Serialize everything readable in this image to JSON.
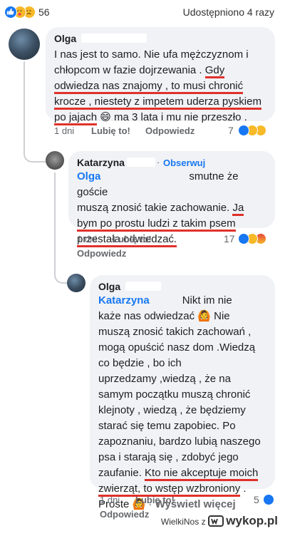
{
  "post": {
    "reaction_count": "56",
    "shares": "Udostępniono 4 razy"
  },
  "comment1": {
    "author": "Olga",
    "text": {
      "l1": "I nas jest to samo.  Nie ufa mężczyznom i",
      "l2": "chłopcom w fazie dojrzewania . ",
      "l2_ul": "Gdy",
      "l3": "odwiedza nas znajomy , to musi chronić",
      "l4": "krocze , niestety z impetem uderza pyskiem",
      "l5_ul": "po jajach",
      "l5_emoji": "😄",
      "l5_rest": " ma 3 lata i mu nie przeszło ."
    },
    "time": "1 dni",
    "like": "Lubię to!",
    "reply": "Odpowiedz",
    "reactions": "7"
  },
  "comment2": {
    "author": "Katarzyna",
    "follow": "Obserwuj",
    "mention": "Olga",
    "text": {
      "l1": "smutne że goście",
      "l2": "muszą znosić takie zachowanie. ",
      "l2_ul": "Ja",
      "l3": "bym po prostu ludzi z takim psem",
      "l4": "przestała odwiedzać."
    },
    "time": "1 dni",
    "like": "Lubię to!",
    "reply": "Odpowiedz",
    "reactions": "17"
  },
  "comment3": {
    "author": "Olga",
    "mention": "Katarzyna",
    "text": {
      "l1": "Nikt im nie",
      "l2": "każe nas odwiedzać",
      "l2_emoji": "🙆",
      "l2_rest": " Nie",
      "l3": "muszą znosić takich zachowań ,",
      "l4": "mogą opuścić nasz dom .Wiedzą",
      "l5": "co będzie , bo ich",
      "l6": "uprzedzamy ,wiedzą , że na",
      "l7": "samym początku muszą chronić",
      "l8": "klejnoty , wiedzą , że będziemy",
      "l9": "starać się temu zapobiec. Po",
      "l10": "zapoznaniu, bardzo lubią naszego",
      "l11": "psa i starają się , zdobyć jego",
      "l12": "zaufanie.  ",
      "l12_ul": "Kto nie akceptuje moich",
      "l13_ul": "zwierząt, to wstęp wzbroniony",
      "l13_rest": " .",
      "l14": "Proste",
      "l14_emoji": "🙆",
      "more": "Wyświetl więcej"
    },
    "time": "1 dni",
    "like": "Lubię to!",
    "reply": "Odpowiedz",
    "reactions": "5"
  },
  "watermark": {
    "author": "WielkiNos",
    "z": "z",
    "site": "wykop.pl"
  },
  "colors": {
    "accent": "#1877f2",
    "underline": "#e0312b",
    "bubble": "#f0f2f5",
    "muted": "#65676b"
  }
}
